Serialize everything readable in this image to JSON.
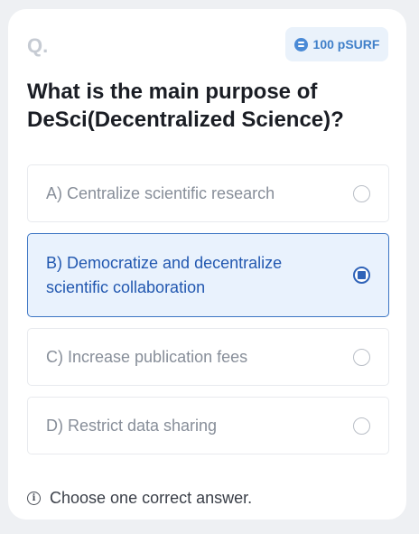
{
  "header": {
    "question_marker": "Q.",
    "reward": {
      "icon": "coin-icon",
      "label": "100 pSURF"
    }
  },
  "question": {
    "text": "What is the main purpose of DeSci(Decentralized Science)?"
  },
  "options": [
    {
      "label": "A) Centralize scientific research",
      "selected": false
    },
    {
      "label": "B) Democratize and decentralize scientific collaboration",
      "selected": true
    },
    {
      "label": "C) Increase publication fees",
      "selected": false
    },
    {
      "label": "D) Restrict data sharing",
      "selected": false
    }
  ],
  "hint": {
    "icon": "info-icon",
    "text": "Choose one correct answer."
  },
  "colors": {
    "accent": "#2f63b8",
    "selected_bg": "#e9f2fd",
    "badge_bg": "#eaf2fb",
    "muted_text": "#878e99"
  }
}
